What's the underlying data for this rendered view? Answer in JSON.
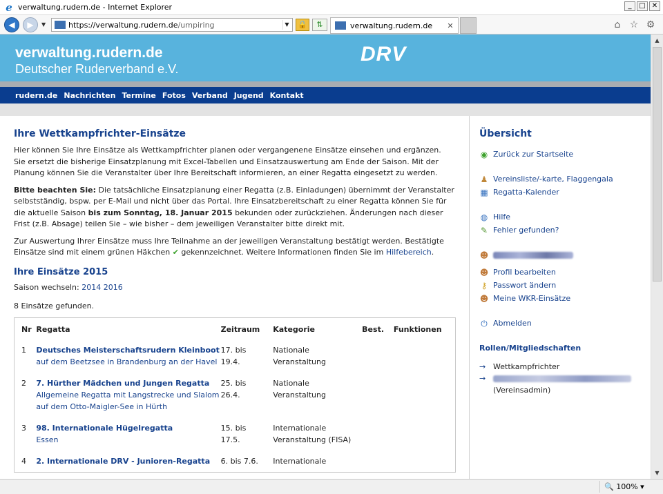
{
  "browser": {
    "window_title": "verwaltung.rudern.de - Internet Explorer",
    "address_host": "https://verwaltung.rudern.de",
    "address_path": "/umpiring",
    "tab_label": "verwaltung.rudern.de",
    "zoom": "100%"
  },
  "site": {
    "title": "verwaltung.rudern.de",
    "subtitle": "Deutscher Ruderverband e.V.",
    "logo": "DRV"
  },
  "nav": [
    "rudern.de",
    "Nachrichten",
    "Termine",
    "Fotos",
    "Verband",
    "Jugend",
    "Kontakt"
  ],
  "main": {
    "heading": "Ihre Wettkampfrichter-Einsätze",
    "intro": "Hier können Sie Ihre Einsätze als Wettkampfrichter planen oder vergangenene Einsätze einsehen und ergänzen. Sie ersetzt die bisherige Einsatzplanung mit Excel-Tabellen und Einsatzauswertung am Ende der Saison. Mit der Planung können Sie die Veranstalter über Ihre Bereitschaft informieren, an einer Regatta eingesetzt zu werden.",
    "note_label": "Bitte beachten Sie:",
    "note_part1": " Die tatsächliche Einsatzplanung einer Regatta (z.B. Einladungen) übernimmt der Veranstalter selbstständig, bspw. per E-Mail und nicht über das Portal. Ihre Einsatzbereitschaft zu einer Regatta können Sie für die aktuelle Saison ",
    "note_deadline": "bis zum Sonntag, 18. Januar 2015",
    "note_part2": " bekunden oder zurückziehen. Änderungen nach dieser Frist (z.B. Absage) teilen Sie – wie bisher – dem jeweiligen Veranstalter bitte direkt mit.",
    "eval_part1": "Zur Auswertung Ihrer Einsätze muss Ihre Teilnahme an der jeweiligen Veranstaltung bestätigt werden. Bestätigte Einsätze sind mit einem grünen Häkchen ",
    "eval_part2": " gekennzeichnet. Weitere Informationen finden Sie im ",
    "eval_link": "Hilfebereich",
    "eval_end": ".",
    "subheading": "Ihre Einsätze 2015",
    "season_label": "Saison wechseln: ",
    "season_links": [
      "2014",
      "2016"
    ],
    "found": "8 Einsätze gefunden.",
    "table": {
      "headers": [
        "Nr",
        "Regatta",
        "Zeitraum",
        "Kategorie",
        "Best.",
        "Funktionen"
      ],
      "rows": [
        {
          "nr": "1",
          "name": "Deutsches Meisterschaftsrudern Kleinboot",
          "sub": "auf dem Beetzsee in Brandenburg an der Havel",
          "zeit1": "17. bis",
          "zeit2": "19.4.",
          "kat1": "Nationale",
          "kat2": "Veranstaltung"
        },
        {
          "nr": "2",
          "name": "7. Hürther Mädchen und Jungen Regatta",
          "sub": "Allgemeine Regatta mit Langstrecke und Slalom auf dem Otto-Maigler-See in Hürth",
          "zeit1": "25. bis",
          "zeit2": "26.4.",
          "kat1": "Nationale",
          "kat2": "Veranstaltung"
        },
        {
          "nr": "3",
          "name": "98. Internationale Hügelregatta",
          "sub": "Essen",
          "zeit1": "15. bis",
          "zeit2": "17.5.",
          "kat1": "Internationale",
          "kat2": "Veranstaltung (FISA)"
        },
        {
          "nr": "4",
          "name": "2. Internationale DRV - Junioren-Regatta",
          "sub": "",
          "zeit1": "6. bis 7.6.",
          "zeit2": "",
          "kat1": "Internationale",
          "kat2": ""
        }
      ]
    }
  },
  "sidebar": {
    "heading": "Übersicht",
    "back": "Zurück zur Startseite",
    "vereinsliste": "Vereinsliste/-karte, Flaggengala",
    "kalender": "Regatta-Kalender",
    "hilfe": "Hilfe",
    "fehler": "Fehler gefunden?",
    "profil": "Profil bearbeiten",
    "passwort": "Passwort ändern",
    "einsaetze": "Meine WKR-Einsätze",
    "abmelden": "Abmelden",
    "rollen_heading": "Rollen/Mitgliedschaften",
    "role1": "Wettkampfrichter",
    "role2_suffix": "(Vereinsadmin)"
  },
  "colors": {
    "header_bg": "#58b3dd",
    "nav_bg": "#0a3d8f",
    "link": "#17428d"
  }
}
